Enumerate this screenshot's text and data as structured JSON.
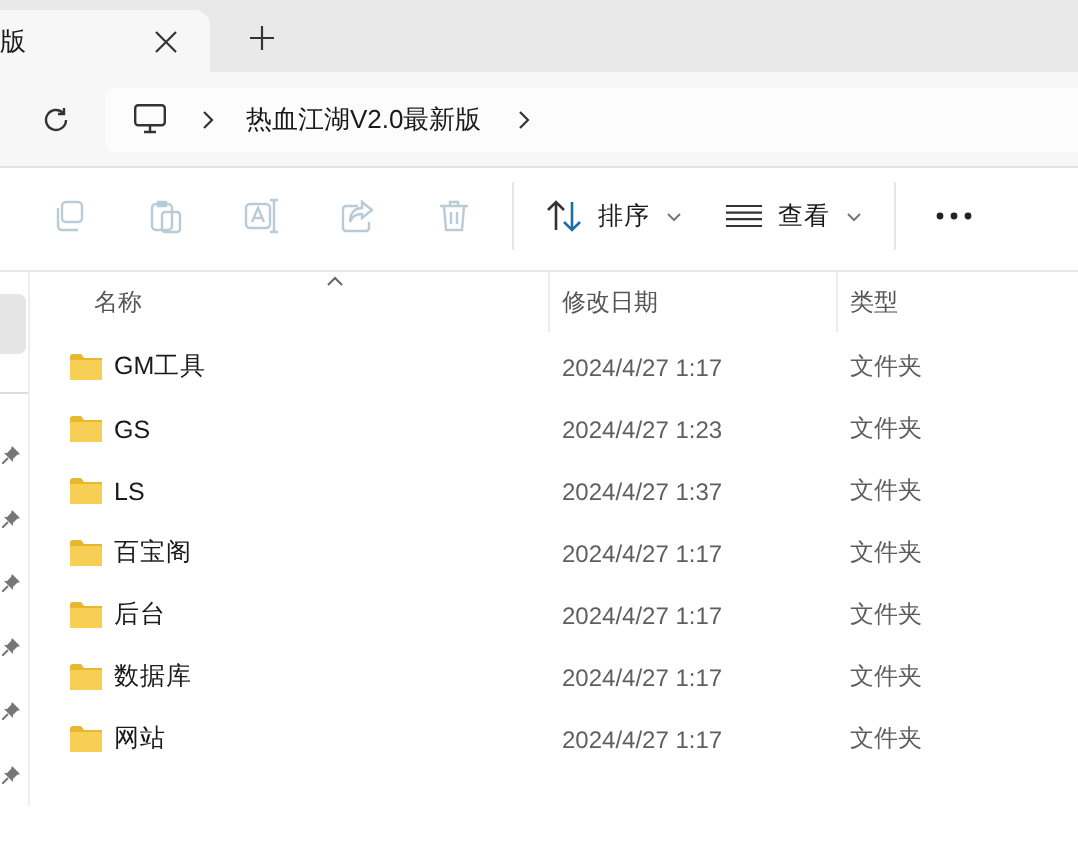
{
  "tab": {
    "title": "版",
    "selected": true
  },
  "address": {
    "segments": [
      "热血江湖V2.0最新版"
    ]
  },
  "toolbar": {
    "actions": [
      {
        "kind": "copy",
        "disabled": true
      },
      {
        "kind": "paste",
        "disabled": true
      },
      {
        "kind": "rename",
        "disabled": true
      },
      {
        "kind": "share",
        "disabled": true
      },
      {
        "kind": "delete",
        "disabled": true
      }
    ],
    "sort": "排序",
    "view": "查看"
  },
  "sidebar": {
    "items": [
      {
        "selected": true,
        "pinned": false
      },
      {
        "selected": false,
        "pinned": true
      },
      {
        "selected": false,
        "pinned": true
      },
      {
        "selected": false,
        "pinned": true
      },
      {
        "selected": false,
        "pinned": true
      },
      {
        "selected": false,
        "pinned": true
      },
      {
        "selected": false,
        "pinned": true
      }
    ]
  },
  "table": {
    "columns": [
      {
        "label": "名称",
        "sorted": true
      },
      {
        "label": "修改日期",
        "sorted": false
      },
      {
        "label": "类型",
        "sorted": false
      }
    ],
    "rows": [
      {
        "name": "GM工具",
        "modified": "2024/4/27 1:17",
        "type": "文件夹"
      },
      {
        "name": "GS",
        "modified": "2024/4/27 1:23",
        "type": "文件夹"
      },
      {
        "name": "LS",
        "modified": "2024/4/27 1:37",
        "type": "文件夹"
      },
      {
        "name": "百宝阁",
        "modified": "2024/4/27 1:17",
        "type": "文件夹"
      },
      {
        "name": "后台",
        "modified": "2024/4/27 1:17",
        "type": "文件夹"
      },
      {
        "name": "数据库",
        "modified": "2024/4/27 1:17",
        "type": "文件夹"
      },
      {
        "name": "网站",
        "modified": "2024/4/27 1:17",
        "type": "文件夹"
      }
    ]
  }
}
